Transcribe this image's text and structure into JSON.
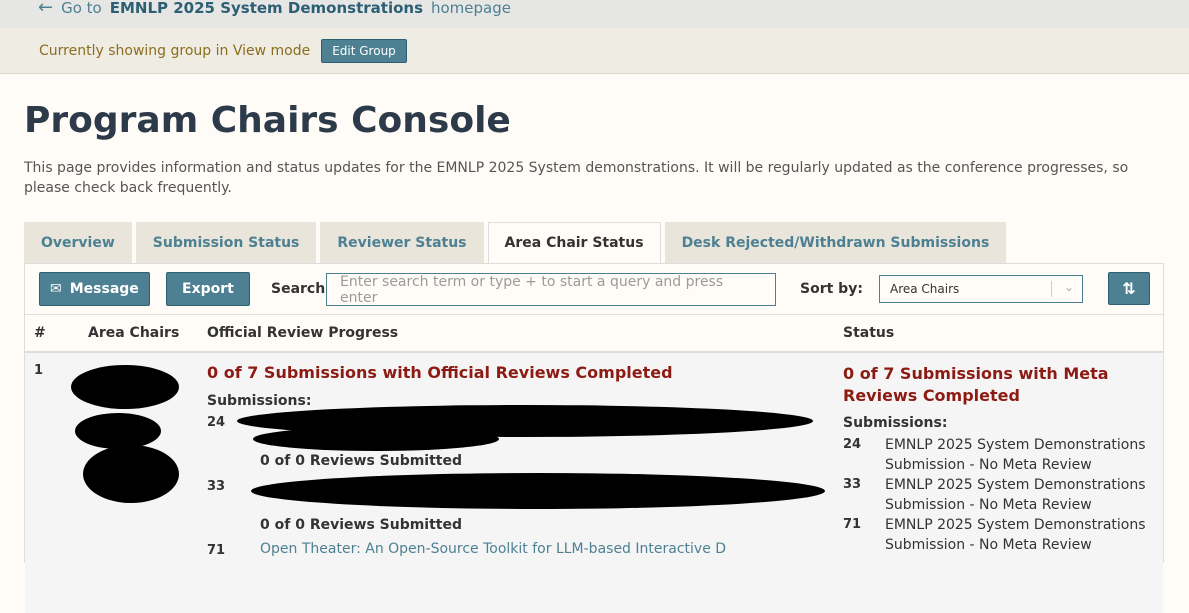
{
  "topbar": {
    "prefix": "Go to",
    "venue": "EMNLP 2025 System Demonstrations",
    "suffix": "homepage"
  },
  "modebar": {
    "text": "Currently showing group in View mode",
    "edit_label": "Edit Group"
  },
  "page": {
    "title": "Program Chairs Console",
    "description": "This page provides information and status updates for the EMNLP 2025 System demonstrations. It will be regularly updated as the conference progresses, so please check back frequently."
  },
  "tabs": [
    {
      "label": "Overview"
    },
    {
      "label": "Submission Status"
    },
    {
      "label": "Reviewer Status"
    },
    {
      "label": "Area Chair Status"
    },
    {
      "label": "Desk Rejected/Withdrawn Submissions"
    }
  ],
  "toolbar": {
    "message_label": "Message",
    "export_label": "Export",
    "search_label": "Search:",
    "search_placeholder": "Enter search term or type + to start a query and press enter",
    "sort_label": "Sort by:",
    "sort_value": "Area Chairs",
    "sort_direction_icon": "sort-icon"
  },
  "table": {
    "headers": [
      "#",
      "Area Chairs",
      "Official Review Progress",
      "Status"
    ],
    "rows": [
      {
        "num": "1",
        "review_progress": "0 of 7 Submissions with Official Reviews Completed",
        "submissions_label": "Submissions:",
        "submissions": [
          {
            "num": "24",
            "reviews": "0 of 0 Reviews Submitted"
          },
          {
            "num": "33",
            "reviews": "0 of 0 Reviews Submitted"
          },
          {
            "num": "71",
            "title_fragment": "Open Theater: An Open-Source Toolkit for LLM-based Interactive D"
          }
        ],
        "status": "0 of 7 Submissions with Meta Reviews Completed",
        "status_submissions_label": "Submissions:",
        "meta": [
          {
            "num": "24",
            "text": "EMNLP 2025 System Demonstrations Submission - No Meta Review"
          },
          {
            "num": "33",
            "text": "EMNLP 2025 System Demonstrations Submission - No Meta Review"
          },
          {
            "num": "71",
            "text": "EMNLP 2025 System Demonstrations Submission - No Meta Review"
          }
        ]
      }
    ]
  }
}
